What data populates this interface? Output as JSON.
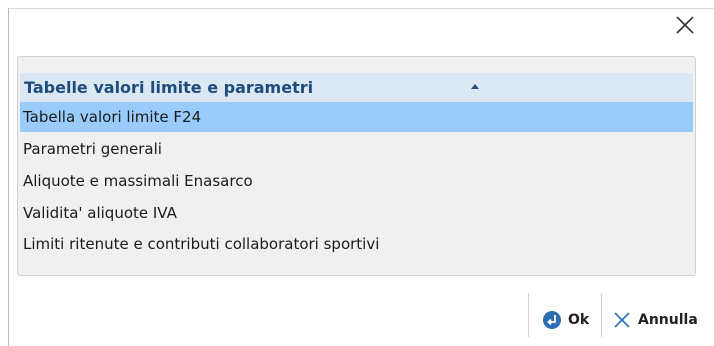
{
  "dialog": {
    "close_icon": "close-icon"
  },
  "list": {
    "header": "Tabelle valori limite e parametri",
    "sort_icon": "sort-ascending-icon",
    "rows": [
      "Tabella valori limite F24",
      "Parametri generali",
      "Aliquote e massimali Enasarco",
      "Validita' aliquote IVA",
      "Limiti ritenute e contributi collaboratori sportivi"
    ],
    "selected_index": 0
  },
  "footer": {
    "ok_label": "Ok",
    "ok_icon": "enter-icon",
    "cancel_label": "Annulla",
    "cancel_icon": "close-icon"
  },
  "colors": {
    "selected_row": "#99ccfb",
    "header_bg": "#dbe7f3",
    "header_text": "#1e4c7c",
    "panel_bg": "#f0f0f0",
    "accent_blue": "#2f6fb5"
  }
}
